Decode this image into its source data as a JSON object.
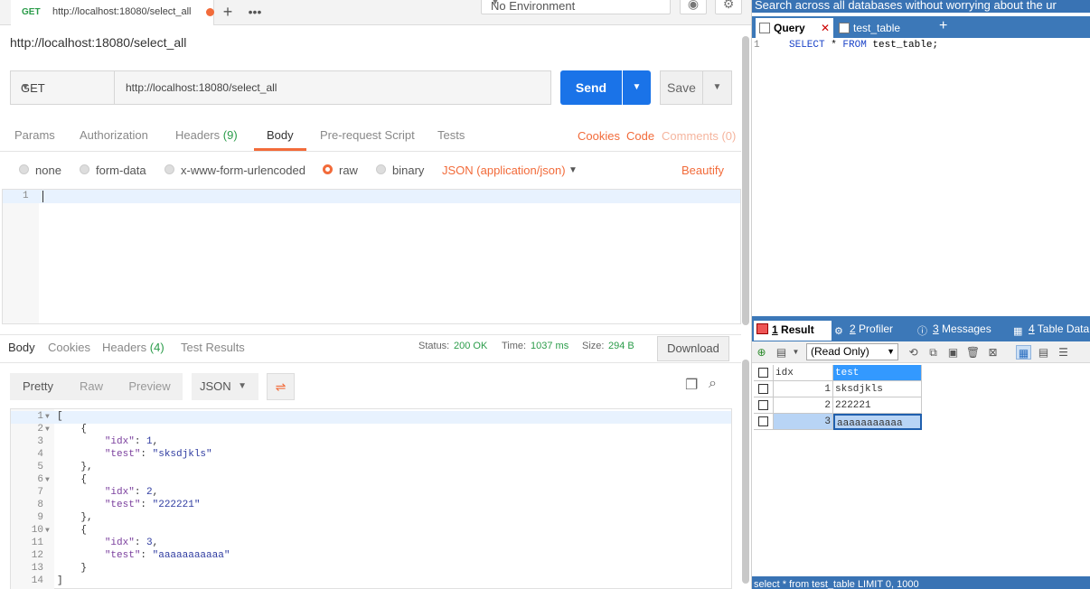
{
  "postman": {
    "tab": {
      "method": "GET",
      "url": "http://localhost:18080/select_all"
    },
    "environment": "No Environment",
    "request_title": "http://localhost:18080/select_all",
    "method": "GET",
    "url": "http://localhost:18080/select_all",
    "send_label": "Send",
    "save_label": "Save",
    "request_tabs": {
      "params": "Params",
      "authorization": "Authorization",
      "headers": "Headers",
      "headers_count": "(9)",
      "body": "Body",
      "prerequest": "Pre-request Script",
      "tests": "Tests",
      "cookies": "Cookies",
      "code": "Code",
      "comments": "Comments (0)"
    },
    "body_options": {
      "none": "none",
      "form_data": "form-data",
      "urlencoded": "x-www-form-urlencoded",
      "raw": "raw",
      "binary": "binary",
      "content_type": "JSON (application/json)",
      "beautify": "Beautify"
    },
    "request_editor_line": "1",
    "response_tabs": {
      "body": "Body",
      "cookies": "Cookies",
      "headers": "Headers",
      "headers_count": "(4)",
      "test_results": "Test Results",
      "status_label": "Status:",
      "status_value": "200 OK",
      "time_label": "Time:",
      "time_value": "1037 ms",
      "size_label": "Size:",
      "size_value": "294 B",
      "download": "Download"
    },
    "response_view": {
      "pretty": "Pretty",
      "raw": "Raw",
      "preview": "Preview",
      "format": "JSON"
    },
    "response_lines": [
      "[",
      "    {",
      "        \"idx\": 1,",
      "        \"test\": \"sksdjkls\"",
      "    },",
      "    {",
      "        \"idx\": 2,",
      "        \"test\": \"222221\"",
      "    },",
      "    {",
      "        \"idx\": 3,",
      "        \"test\": \"aaaaaaaaaaa\"",
      "    }",
      "]"
    ]
  },
  "sql": {
    "search_bar": "Search across all databases without worrying about the ur",
    "tabs": {
      "query": "Query",
      "table": "test_table"
    },
    "editor_line": "1",
    "editor_code": {
      "select": "SELECT",
      "star": " * ",
      "from": "FROM",
      "rest": " test_table;"
    },
    "result_tabs": {
      "result_num": "1",
      "result": " Result",
      "profiler_num": "2",
      "profiler": " Profiler",
      "messages_num": "3",
      "messages": " Messages",
      "tabledata_num": "4",
      "tabledata": " Table Data"
    },
    "readonly": "(Read Only)",
    "grid": {
      "columns": [
        "idx",
        "test"
      ],
      "rows": [
        [
          "1",
          "sksdjkls"
        ],
        [
          "2",
          "222221"
        ],
        [
          "3",
          "aaaaaaaaaaa"
        ]
      ]
    },
    "status_bar": "select * from test_table LIMIT 0, 1000"
  }
}
